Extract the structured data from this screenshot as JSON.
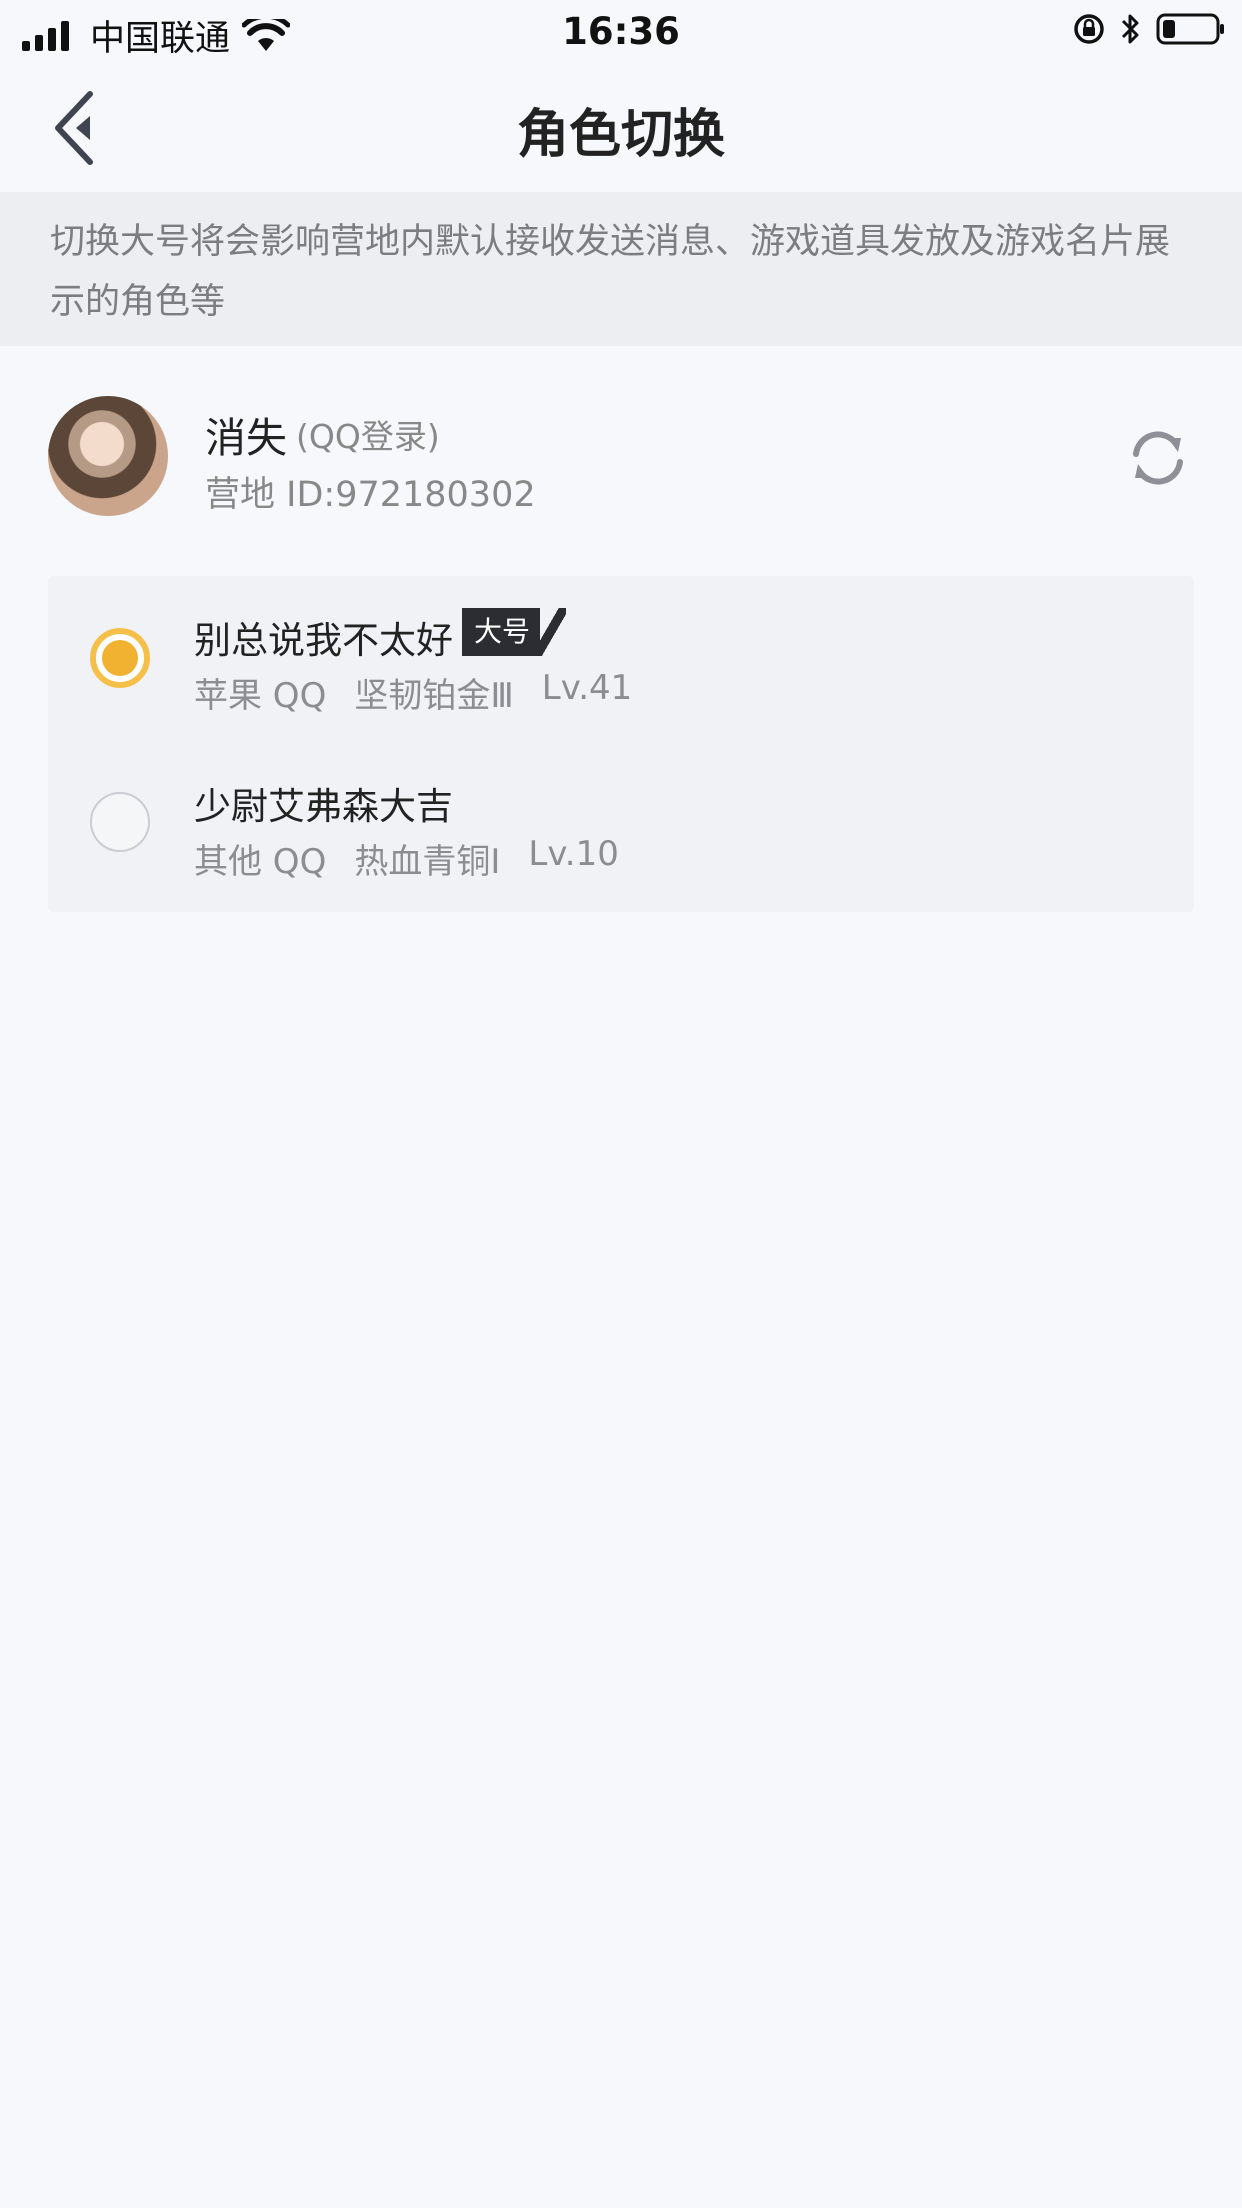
{
  "status_bar": {
    "carrier": "中国联通",
    "time": "16:36",
    "icons": [
      "signal-icon",
      "wifi-icon",
      "orientation-lock-icon",
      "bluetooth-icon",
      "battery-icon"
    ]
  },
  "nav": {
    "title": "角色切换",
    "back_icon": "back-chevron-icon"
  },
  "notice": {
    "text": "切换大号将会影响营地内默认接收发送消息、游戏道具发放及游戏名片展示的角色等"
  },
  "profile": {
    "name": "消失",
    "login_type": "(QQ登录)",
    "id_text": "营地 ID:972180302",
    "refresh_icon": "refresh-icon"
  },
  "roles": [
    {
      "name": "别总说我不太好",
      "badge": "大号",
      "platform": "苹果 QQ",
      "rank": "坚韧铂金Ⅲ",
      "level": "Lv.41",
      "selected": true
    },
    {
      "name": "少尉艾弗森大吉",
      "platform": "其他 QQ",
      "rank": "热血青铜Ⅰ",
      "level": "Lv.10",
      "selected": false
    }
  ],
  "colors": {
    "accent": "#f1b232",
    "background": "#f6f8fb",
    "notice_bg": "#eceef1",
    "badge_bg": "#2b2d33"
  }
}
